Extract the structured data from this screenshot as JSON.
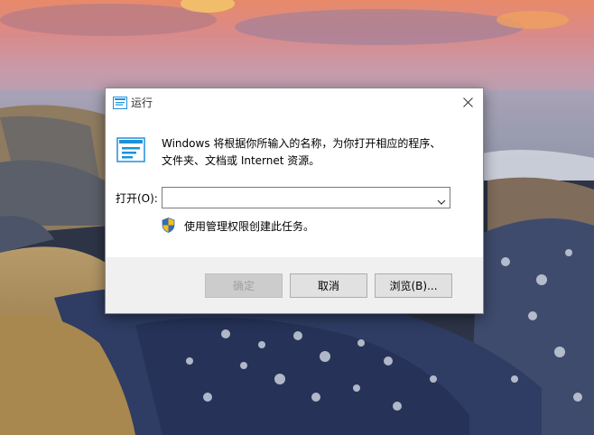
{
  "dialog": {
    "title": "运行",
    "description_line1": "Windows 将根据你所输入的名称，为你打开相应的程序、",
    "description_line2": "文件夹、文档或 Internet 资源。",
    "open_label": "打开(O):",
    "open_value": "",
    "admin_note": "使用管理权限创建此任务。",
    "ok_label": "确定",
    "cancel_label": "取消",
    "browse_label": "浏览(B)...",
    "ok_enabled": false
  },
  "icons": {
    "title": "run-icon",
    "close": "close-icon",
    "program": "run-program-icon",
    "dropdown": "chevron-down-icon",
    "shield": "uac-shield-icon"
  },
  "colors": {
    "accent": "#1e90d8",
    "disabled_text": "#a0a0a0"
  }
}
